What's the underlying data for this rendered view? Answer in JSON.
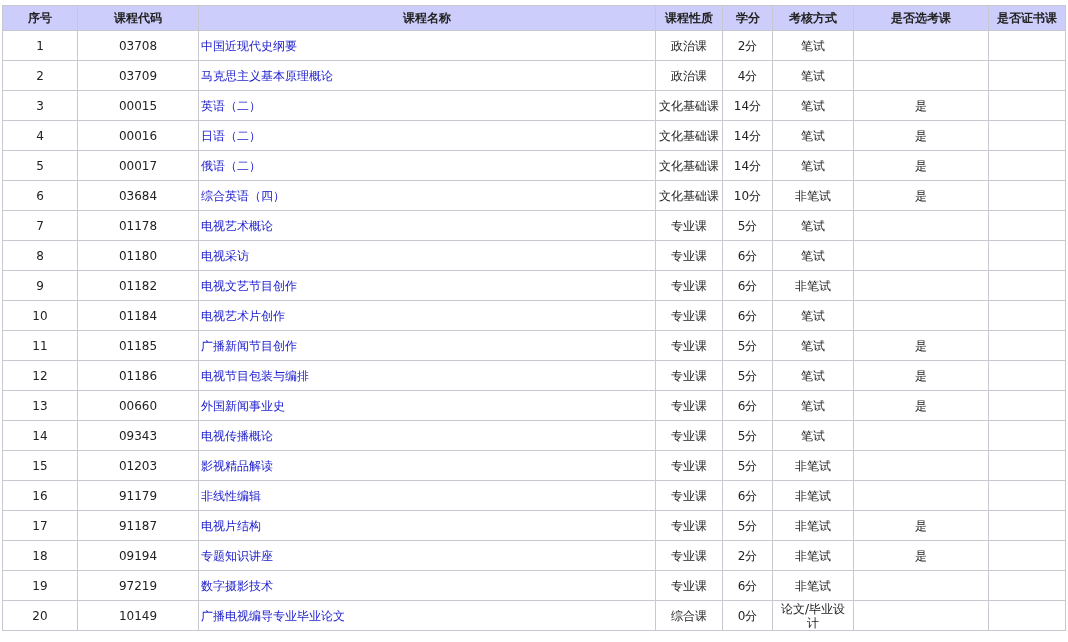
{
  "table": {
    "columns": [
      "序号",
      "课程代码",
      "课程名称",
      "课程性质",
      "学分",
      "考核方式",
      "是否选考课",
      "是否证书课"
    ],
    "rows": [
      {
        "seq": "1",
        "code": "03708",
        "name": "中国近现代史纲要",
        "type": "政治课",
        "credits": "2分",
        "exam": "笔试"
      },
      {
        "seq": "2",
        "code": "03709",
        "name": "马克思主义基本原理概论",
        "type": "政治课",
        "credits": "4分",
        "exam": "笔试"
      },
      {
        "seq": "3",
        "code": "00015",
        "name": "英语（二）",
        "type": "文化基础课",
        "credits": "14分",
        "exam": "笔试",
        "elective": "是"
      },
      {
        "seq": "4",
        "code": "00016",
        "name": "日语（二）",
        "type": "文化基础课",
        "credits": "14分",
        "exam": "笔试",
        "elective": "是"
      },
      {
        "seq": "5",
        "code": "00017",
        "name": "俄语（二）",
        "type": "文化基础课",
        "credits": "14分",
        "exam": "笔试",
        "elective": "是"
      },
      {
        "seq": "6",
        "code": "03684",
        "name": "综合英语（四）",
        "type": "文化基础课",
        "credits": "10分",
        "exam": "非笔试",
        "elective": "是"
      },
      {
        "seq": "7",
        "code": "01178",
        "name": "电视艺术概论",
        "type": "专业课",
        "credits": "5分",
        "exam": "笔试"
      },
      {
        "seq": "8",
        "code": "01180",
        "name": "电视采访",
        "type": "专业课",
        "credits": "6分",
        "exam": "笔试"
      },
      {
        "seq": "9",
        "code": "01182",
        "name": "电视文艺节目创作",
        "type": "专业课",
        "credits": "6分",
        "exam": "非笔试"
      },
      {
        "seq": "10",
        "code": "01184",
        "name": "电视艺术片创作",
        "type": "专业课",
        "credits": "6分",
        "exam": "笔试"
      },
      {
        "seq": "11",
        "code": "01185",
        "name": "广播新闻节目创作",
        "type": "专业课",
        "credits": "5分",
        "exam": "笔试",
        "elective": "是"
      },
      {
        "seq": "12",
        "code": "01186",
        "name": "电视节目包装与编排",
        "type": "专业课",
        "credits": "5分",
        "exam": "笔试",
        "elective": "是"
      },
      {
        "seq": "13",
        "code": "00660",
        "name": "外国新闻事业史",
        "type": "专业课",
        "credits": "6分",
        "exam": "笔试",
        "elective": "是"
      },
      {
        "seq": "14",
        "code": "09343",
        "name": "电视传播概论",
        "type": "专业课",
        "credits": "5分",
        "exam": "笔试"
      },
      {
        "seq": "15",
        "code": "01203",
        "name": "影视精品解读",
        "type": "专业课",
        "credits": "5分",
        "exam": "非笔试"
      },
      {
        "seq": "16",
        "code": "91179",
        "name": "非线性编辑",
        "type": "专业课",
        "credits": "6分",
        "exam": "非笔试"
      },
      {
        "seq": "17",
        "code": "91187",
        "name": "电视片结构",
        "type": "专业课",
        "credits": "5分",
        "exam": "非笔试",
        "elective": "是"
      },
      {
        "seq": "18",
        "code": "09194",
        "name": "专题知识讲座",
        "type": "专业课",
        "credits": "2分",
        "exam": "非笔试",
        "elective": "是"
      },
      {
        "seq": "19",
        "code": "97219",
        "name": "数字摄影技术",
        "type": "专业课",
        "credits": "6分",
        "exam": "非笔试"
      },
      {
        "seq": "20",
        "code": "10149",
        "name": "广播电视编导专业毕业论文",
        "type": "综合课",
        "credits": "0分",
        "exam": "论文/毕业设计"
      }
    ]
  }
}
